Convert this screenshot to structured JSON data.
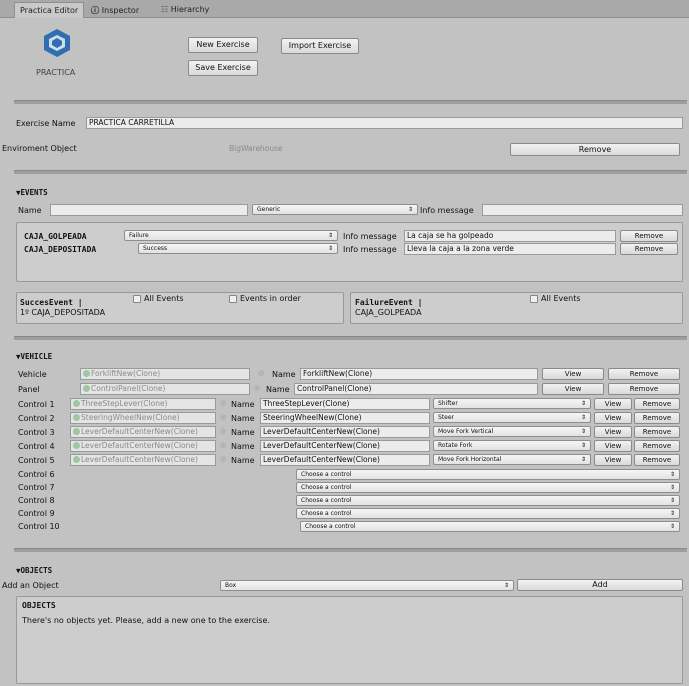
{
  "tabs": {
    "editor": "Practica Editor",
    "inspector": "Inspector",
    "hierarchy": "Hierarchy"
  },
  "logo_text": "PRACTICA",
  "buttons": {
    "new_exercise": "New Exercise",
    "save_exercise": "Save Exercise",
    "import_exercise": "Import Exercise"
  },
  "exercise": {
    "name_label": "Exercise Name",
    "name_value": "PRACTICA CARRETILLA",
    "env_label": "Enviroment Object",
    "env_value": "BigWarehouse",
    "remove": "Remove"
  },
  "events": {
    "header": "EVENTS",
    "name_label": "Name",
    "name_value": "",
    "type_value": "Generic",
    "info_label": "Info message",
    "info_value": "",
    "items": [
      {
        "name": "CAJA_GOLPEADA",
        "type": "Failure",
        "info_label": "Info message",
        "info": "La caja se ha golpeado",
        "remove": "Remove"
      },
      {
        "name": "CAJA_DEPOSITADA",
        "type": "Success",
        "info_label": "Info message",
        "info": "Lleva la caja a la zona verde",
        "remove": "Remove"
      }
    ],
    "success_title": "SuccesEvent |",
    "success_item": "1º CAJA_DEPOSITADA",
    "all_events": "All Events",
    "events_in_order": "Events in order",
    "failure_title": "FailureEvent |",
    "failure_item": "CAJA_GOLPEADA",
    "failure_all": "All Events"
  },
  "vehicle": {
    "header": "VEHICLE",
    "name_label": "Name",
    "view": "View",
    "remove": "Remove",
    "vehicle_label": "Vehicle",
    "vehicle_obj": "ForkliftNew(Clone)",
    "vehicle_name": "ForkliftNew(Clone)",
    "panel_label": "Panel",
    "panel_obj": "ControlPanel(Clone)",
    "panel_name": "ControlPanel(Clone)",
    "controls": [
      {
        "label": "Control 1",
        "obj": "ThreeStepLever(Clone)",
        "name": "ThreeStepLever(Clone)",
        "action": "Shifter"
      },
      {
        "label": "Control 2",
        "obj": "SteeringWheelNew(Clone)",
        "name": "SteeringWheelNew(Clone)",
        "action": "Steer"
      },
      {
        "label": "Control 3",
        "obj": "LeverDefaultCenterNew(Clone)",
        "name": "LeverDefaultCenterNew(Clone)",
        "action": "Move Fork Vertical"
      },
      {
        "label": "Control 4",
        "obj": "LeverDefaultCenterNew(Clone)",
        "name": "LeverDefaultCenterNew(Clone)",
        "action": "Rotate Fork"
      },
      {
        "label": "Control 5",
        "obj": "LeverDefaultCenterNew(Clone)",
        "name": "LeverDefaultCenterNew(Clone)",
        "action": "Move Fork Horizontal"
      }
    ],
    "empty_controls": [
      {
        "label": "Control 6",
        "choose": "Choose a control"
      },
      {
        "label": "Control 7",
        "choose": "Choose a control"
      },
      {
        "label": "Control 8",
        "choose": "Choose a control"
      },
      {
        "label": "Control 9",
        "choose": "Choose a control"
      },
      {
        "label": "Control 10",
        "choose": "Choose a control"
      }
    ]
  },
  "objects": {
    "header": "OBJECTS",
    "add_label": "Add an Object",
    "add_type": "Box",
    "add_button": "Add",
    "list_title": "OBJECTS",
    "empty_message": "There's no objects yet. Please, add a new one to the exercise."
  }
}
